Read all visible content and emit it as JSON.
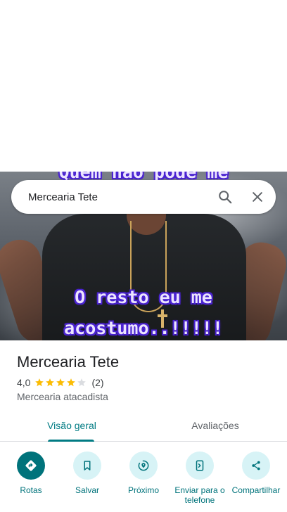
{
  "search": {
    "query": "Mercearia Tete"
  },
  "hero": {
    "overlay_top": "Quem não pode me",
    "overlay_mid": "O resto eu me",
    "overlay_bottom": "acostumo..!!!!!"
  },
  "place": {
    "name": "Mercearia Tete",
    "rating": "4,0",
    "stars": 4,
    "reviews_count": "(2)",
    "category": "Mercearia atacadista"
  },
  "tabs": [
    {
      "label": "Visão geral",
      "active": true
    },
    {
      "label": "Avaliações",
      "active": false
    }
  ],
  "actions": [
    {
      "label": "Rotas",
      "icon": "directions-icon"
    },
    {
      "label": "Salvar",
      "icon": "bookmark-icon"
    },
    {
      "label": "Próximo",
      "icon": "nearby-icon"
    },
    {
      "label": "Enviar para o telefone",
      "icon": "send-to-phone-icon"
    },
    {
      "label": "Compartilhar",
      "icon": "share-icon"
    }
  ],
  "colors": {
    "accent": "#007b83",
    "action_bg": "#d7f3f6",
    "star": "#fbbc04",
    "star_empty": "#dadce0"
  }
}
